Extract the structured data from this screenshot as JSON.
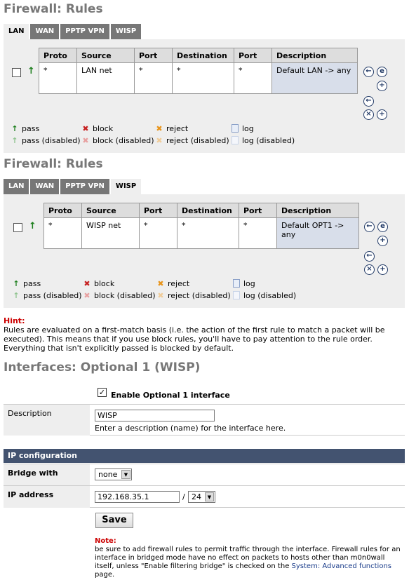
{
  "firewall1": {
    "title": "Firewall: Rules",
    "tabs": [
      "LAN",
      "WAN",
      "PPTP VPN",
      "WISP"
    ],
    "active_tab": "LAN",
    "headers": [
      "Proto",
      "Source",
      "Port",
      "Destination",
      "Port",
      "Description"
    ],
    "rule": {
      "proto": "*",
      "source": "LAN net",
      "port": "*",
      "destination": "*",
      "dport": "*",
      "description": "Default LAN -> any"
    }
  },
  "firewall2": {
    "title": "Firewall: Rules",
    "tabs": [
      "LAN",
      "WAN",
      "PPTP VPN",
      "WISP"
    ],
    "active_tab": "WISP",
    "headers": [
      "Proto",
      "Source",
      "Port",
      "Destination",
      "Port",
      "Description"
    ],
    "rule": {
      "proto": "*",
      "source": "WISP net",
      "port": "*",
      "destination": "*",
      "dport": "*",
      "description": "Default OPT1 -> any"
    }
  },
  "legend": {
    "pass": "pass",
    "pass_disabled": "pass (disabled)",
    "block": "block",
    "block_disabled": "block (disabled)",
    "reject": "reject",
    "reject_disabled": "reject (disabled)",
    "log": "log",
    "log_disabled": "log (disabled)"
  },
  "hint": {
    "label": "Hint:",
    "text": "Rules are evaluated on a first-match basis (i.e. the action of the first rule to match a packet will be executed). This means that if you use block rules, you'll have to pay attention to the rule order. Everything that isn't explicitly passed is blocked by default."
  },
  "interfaces": {
    "title": "Interfaces: Optional 1 (WISP)",
    "enable_label": "Enable Optional 1 interface",
    "enable_checked": true,
    "description_label": "Description",
    "description_value": "WISP",
    "description_help": "Enter a description (name) for the interface here.",
    "ip_config_header": "IP configuration",
    "bridge_label": "Bridge with",
    "bridge_value": "none",
    "ip_label": "IP address",
    "ip_value": "192.168.35.1",
    "ip_sep": "/",
    "subnet_value": "24",
    "save_label": "Save",
    "note_label": "Note:",
    "note_text_1": "be sure to add firewall rules to permit traffic through the interface. Firewall rules for an interface in bridged mode have no effect on packets to hosts other than m0n0wall itself, unless \"Enable filtering bridge\" is checked on the ",
    "note_link": "System: Advanced functions",
    "note_text_2": " page."
  },
  "colors": {
    "title": "#777777",
    "tab": "#777777",
    "panel": "#eeeeee",
    "header_bar": "#435370",
    "note": "#cc0000",
    "link": "#1a3c8a"
  },
  "icons": [
    "arrow-up-icon",
    "arrow-left-icon",
    "edit-icon",
    "plus-icon",
    "delete-icon",
    "block-icon",
    "reject-icon",
    "log-icon"
  ]
}
